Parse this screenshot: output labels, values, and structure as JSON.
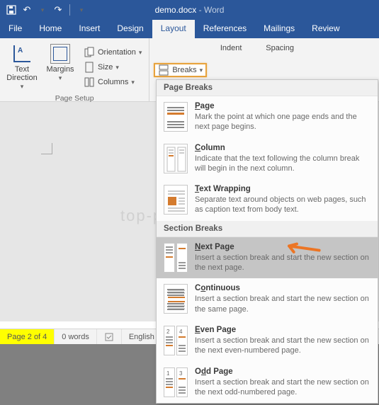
{
  "titlebar": {
    "doc_name": "demo.docx",
    "app_name": "Word"
  },
  "tabs": [
    "File",
    "Home",
    "Insert",
    "Design",
    "Layout",
    "References",
    "Mailings",
    "Review"
  ],
  "ribbon": {
    "text_direction": "Text Direction",
    "margins": "Margins",
    "orientation": "Orientation",
    "size": "Size",
    "columns": "Columns",
    "breaks": "Breaks",
    "page_setup": "Page Setup",
    "indent": "Indent",
    "spacing": "Spacing"
  },
  "dropdown": {
    "page_breaks_header": "Page Breaks",
    "section_breaks_header": "Section Breaks",
    "page": {
      "title": "Page",
      "desc": "Mark the point at which one page ends and the next page begins."
    },
    "column": {
      "title": "Column",
      "desc": "Indicate that the text following the column break will begin in the next column."
    },
    "text_wrapping": {
      "title": "Text Wrapping",
      "desc": "Separate text around objects on web pages, such as caption text from body text."
    },
    "next_page": {
      "title": "Next Page",
      "desc": "Insert a section break and start the new section on the next page."
    },
    "continuous": {
      "title": "Continuous",
      "desc": "Insert a section break and start the new section on the same page."
    },
    "even_page": {
      "title": "Even Page",
      "desc": "Insert a section break and start the new section on the next even-numbered page."
    },
    "odd_page": {
      "title": "Odd Page",
      "desc": "Insert a section break and start the new section on the next odd-numbered page."
    }
  },
  "watermark": "top-password.com",
  "statusbar": {
    "page_current": "Page 2",
    "page_total": "of 4",
    "words": "0 words",
    "language": "English"
  }
}
